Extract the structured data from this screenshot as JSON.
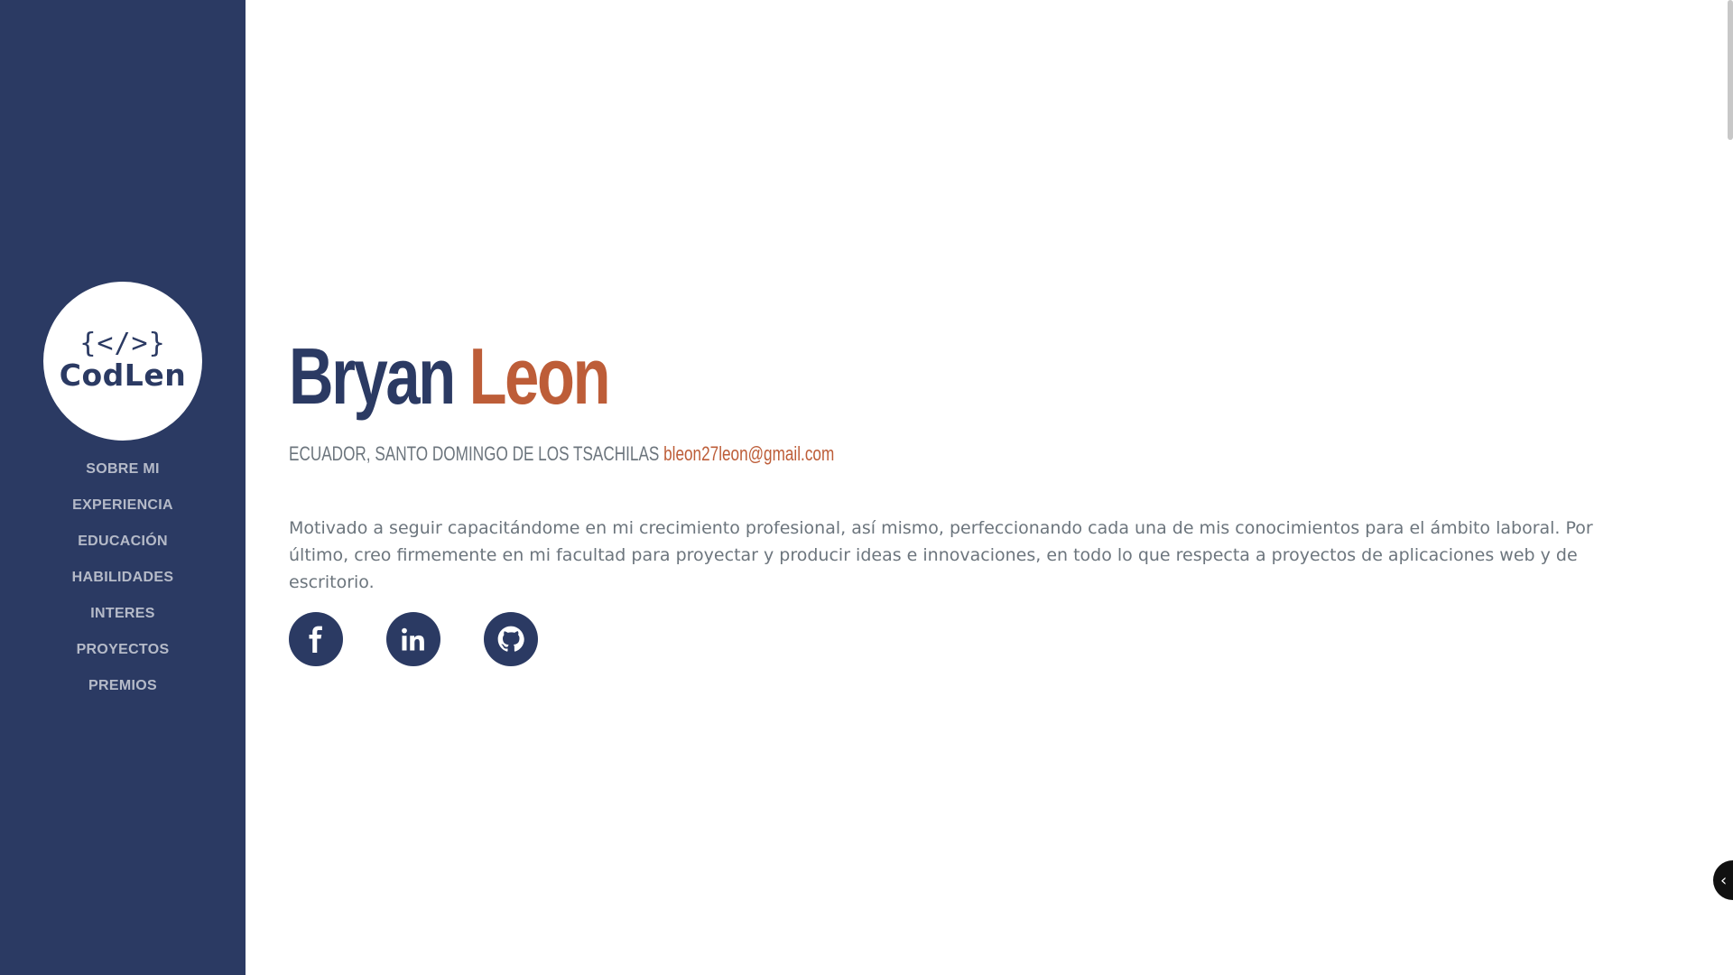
{
  "logo": {
    "symbol": "{</>}",
    "name": "CodLen"
  },
  "nav": {
    "items": [
      {
        "label": "SOBRE MI"
      },
      {
        "label": "EXPERIENCIA"
      },
      {
        "label": "EDUCACIÓN"
      },
      {
        "label": "HABILIDADES"
      },
      {
        "label": "INTERES"
      },
      {
        "label": "PROYECTOS"
      },
      {
        "label": "PREMIOS"
      }
    ]
  },
  "about": {
    "first_name": "Bryan",
    "last_name": "Leon",
    "location": "ECUADOR, SANTO DOMINGO DE LOS TSACHILAS",
    "email": "bleon27leon@gmail.com",
    "description": "Motivado a seguir capacitándome en mi crecimiento profesional, así mismo, perfeccionando cada una de mis conocimientos para el ámbito laboral. Por último, creo firmemente en mi facultad para proyectar y producir ideas e innovaciones, en todo lo que respecta a proyectos de aplicaciones web y de escritorio."
  },
  "social": [
    {
      "icon": "facebook-icon"
    },
    {
      "icon": "linkedin-icon"
    },
    {
      "icon": "github-icon"
    }
  ],
  "float_button": {
    "icon": "chevron-left-icon",
    "glyph": "‹"
  },
  "colors": {
    "primary": "#2b3a63",
    "accent": "#bd5d38",
    "muted": "#6c757d"
  }
}
